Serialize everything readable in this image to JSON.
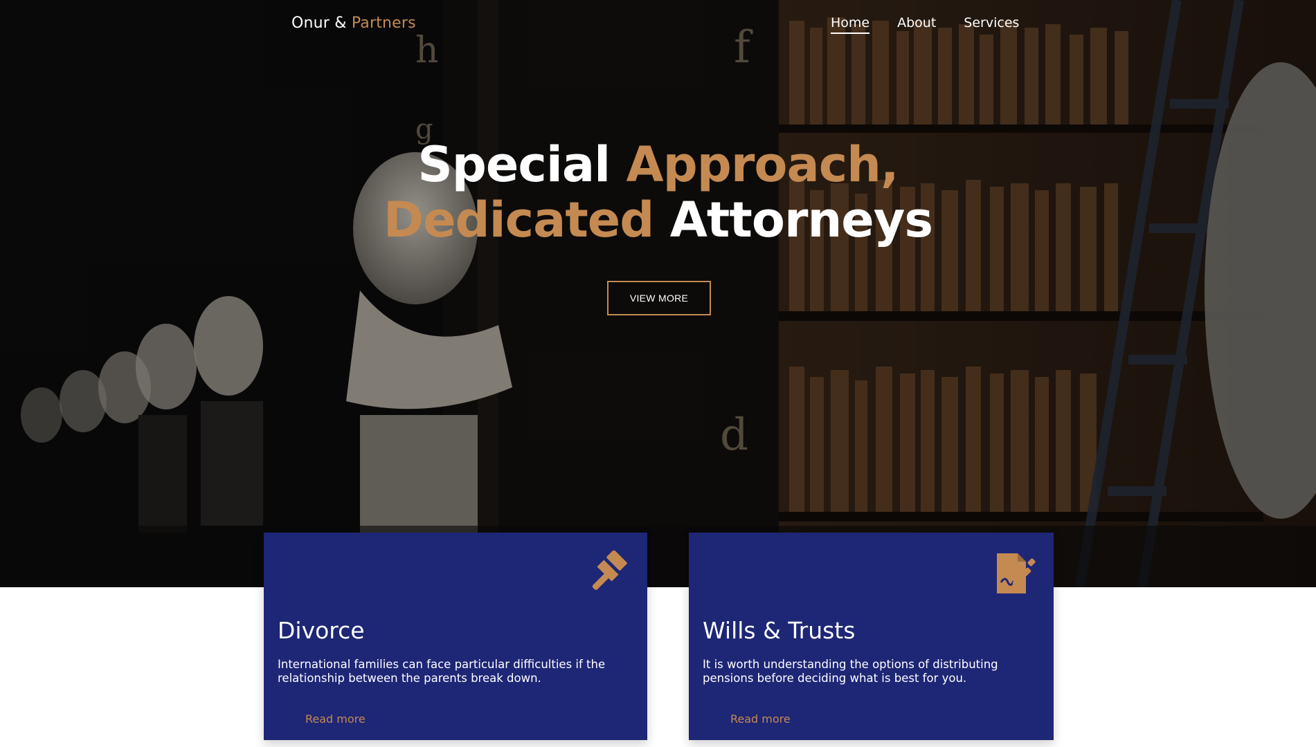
{
  "header": {
    "logo": {
      "primary": "Onur &",
      "accent": "Partners"
    },
    "nav": [
      {
        "label": "Home",
        "active": true
      },
      {
        "label": "About",
        "active": false
      },
      {
        "label": "Services",
        "active": false
      }
    ]
  },
  "hero": {
    "headline": {
      "line1_white": "Special",
      "line1_gold": "Approach,",
      "line2_gold": "Dedicated",
      "line2_white": "Attorneys"
    },
    "cta_label": "VIEW MORE"
  },
  "services": [
    {
      "title": "Divorce",
      "icon": "gavel-icon",
      "description": "International families can face particular difficulties if the relationship between the parents break down.",
      "link_label": "Read more"
    },
    {
      "title": "Wills & Trusts",
      "icon": "signed-document-icon",
      "description": "It is worth understanding the options of distributing pensions before deciding what is best for you.",
      "link_label": "Read more"
    }
  ],
  "colors": {
    "accent_gold": "#c48a52",
    "card_navy": "#1e2676",
    "text_white": "#ffffff"
  }
}
